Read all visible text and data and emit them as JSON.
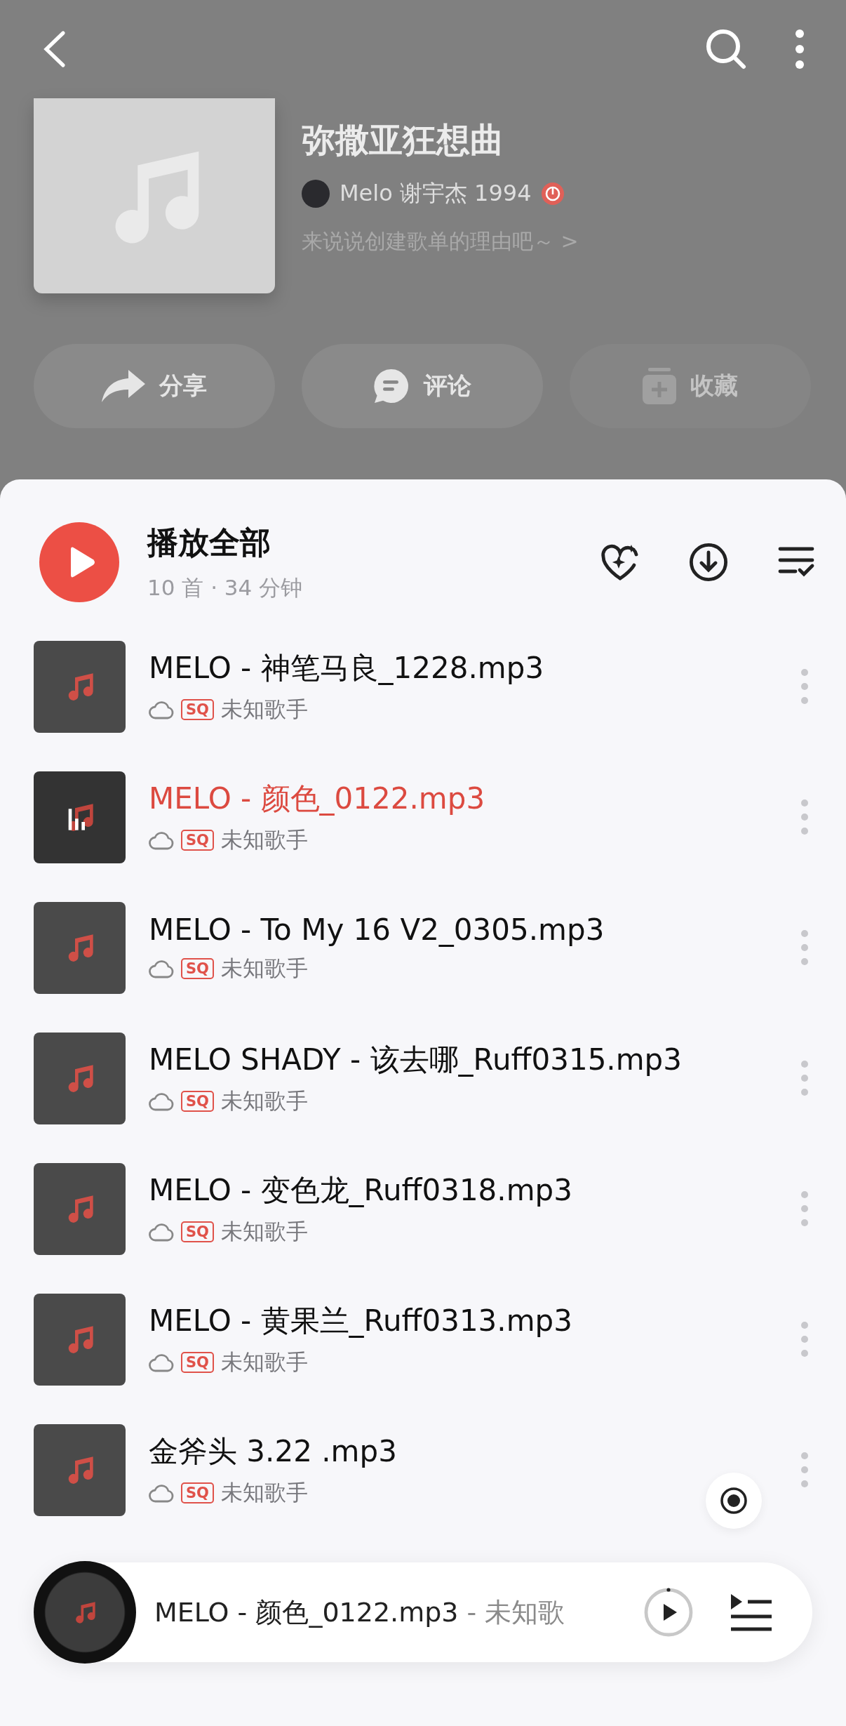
{
  "header": {
    "title": "弥撒亚狂想曲",
    "owner": "Melo 谢宇杰 1994",
    "description": "来说说创建歌单的理由吧～ >"
  },
  "actions": [
    {
      "kind": "share",
      "label": "分享",
      "disabled": false
    },
    {
      "kind": "comment",
      "label": "评论",
      "disabled": false
    },
    {
      "kind": "collect",
      "label": "收藏",
      "disabled": true
    }
  ],
  "play_all": {
    "label": "播放全部",
    "meta": "10 首 · 34 分钟"
  },
  "songs": [
    {
      "title": "MELO - 神笔马良_1228.mp3",
      "quality": "SQ",
      "artist": "未知歌手",
      "playing": false
    },
    {
      "title": "MELO - 颜色_0122.mp3",
      "quality": "SQ",
      "artist": "未知歌手",
      "playing": true
    },
    {
      "title": "MELO - To My 16 V2_0305.mp3",
      "quality": "SQ",
      "artist": "未知歌手",
      "playing": false
    },
    {
      "title": "MELO SHADY - 该去哪_Ruff0315.mp3",
      "quality": "SQ",
      "artist": "未知歌手",
      "playing": false
    },
    {
      "title": "MELO - 变色龙_Ruff0318.mp3",
      "quality": "SQ",
      "artist": "未知歌手",
      "playing": false
    },
    {
      "title": "MELO - 黄果兰_Ruff0313.mp3",
      "quality": "SQ",
      "artist": "未知歌手",
      "playing": false
    },
    {
      "title": "金斧头 3.22 .mp3",
      "quality": "SQ",
      "artist": "未知歌手",
      "playing": false
    }
  ],
  "mini_player": {
    "title": "MELO - 颜色_0122.mp3",
    "artist": "- 未知歌"
  }
}
